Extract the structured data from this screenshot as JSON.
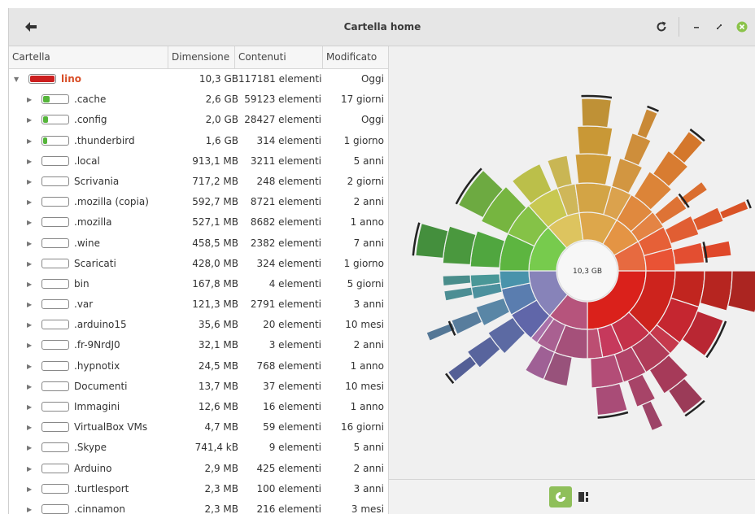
{
  "window": {
    "title": "Cartella home"
  },
  "columns": {
    "folder": "Cartella",
    "size": "Dimensione",
    "contents": "Contenuti",
    "modified": "Modificato"
  },
  "root": {
    "name": "lino",
    "size": "10,3 GB",
    "contents": "117181 elementi",
    "modified": "Oggi"
  },
  "rows": [
    {
      "name": ".cache",
      "size": "2,6 GB",
      "contents": "59123 elementi",
      "modified": "17 giorni",
      "fill": 0.25
    },
    {
      "name": ".config",
      "size": "2,0 GB",
      "contents": "28427 elementi",
      "modified": "Oggi",
      "fill": 0.19
    },
    {
      "name": ".thunderbird",
      "size": "1,6 GB",
      "contents": "314 elementi",
      "modified": "1 giorno",
      "fill": 0.15
    },
    {
      "name": ".local",
      "size": "913,1 MB",
      "contents": "3211 elementi",
      "modified": "5 anni",
      "fill": 0
    },
    {
      "name": "Scrivania",
      "size": "717,2 MB",
      "contents": "248 elementi",
      "modified": "2 giorni",
      "fill": 0
    },
    {
      "name": ".mozilla (copia)",
      "size": "592,7 MB",
      "contents": "8721 elementi",
      "modified": "2 anni",
      "fill": 0
    },
    {
      "name": ".mozilla",
      "size": "527,1 MB",
      "contents": "8682 elementi",
      "modified": "1 anno",
      "fill": 0
    },
    {
      "name": ".wine",
      "size": "458,5 MB",
      "contents": "2382 elementi",
      "modified": "7 anni",
      "fill": 0
    },
    {
      "name": "Scaricati",
      "size": "428,0 MB",
      "contents": "324 elementi",
      "modified": "1 giorno",
      "fill": 0
    },
    {
      "name": "bin",
      "size": "167,8 MB",
      "contents": "4 elementi",
      "modified": "5 giorni",
      "fill": 0
    },
    {
      "name": ".var",
      "size": "121,3 MB",
      "contents": "2791 elementi",
      "modified": "3 anni",
      "fill": 0
    },
    {
      "name": ".arduino15",
      "size": "35,6 MB",
      "contents": "20 elementi",
      "modified": "10 mesi",
      "fill": 0
    },
    {
      "name": ".fr-9NrdJ0",
      "size": "32,1 MB",
      "contents": "3 elementi",
      "modified": "2 anni",
      "fill": 0
    },
    {
      "name": ".hypnotix",
      "size": "24,5 MB",
      "contents": "768 elementi",
      "modified": "1 anno",
      "fill": 0
    },
    {
      "name": "Documenti",
      "size": "13,7 MB",
      "contents": "37 elementi",
      "modified": "10 mesi",
      "fill": 0
    },
    {
      "name": "Immagini",
      "size": "12,6 MB",
      "contents": "16 elementi",
      "modified": "1 anno",
      "fill": 0
    },
    {
      "name": "VirtualBox VMs",
      "size": "4,7 MB",
      "contents": "59 elementi",
      "modified": "16 giorni",
      "fill": 0
    },
    {
      "name": ".Skype",
      "size": "741,4 kB",
      "contents": "9 elementi",
      "modified": "5 anni",
      "fill": 0
    },
    {
      "name": "Arduino",
      "size": "2,9 MB",
      "contents": "425 elementi",
      "modified": "2 anni",
      "fill": 0
    },
    {
      "name": ".turtlesport",
      "size": "2,3 MB",
      "contents": "100 elementi",
      "modified": "3 anni",
      "fill": 0
    },
    {
      "name": ".cinnamon",
      "size": "2,3 MB",
      "contents": "216 elementi",
      "modified": "3 mesi",
      "fill": 0
    }
  ],
  "chart": {
    "center_label": "10,3 GB"
  },
  "colors": {
    "root_bar": "#cc1f1f",
    "usage_bar": "#55b53a",
    "accent": "#8fbf5a"
  },
  "icons": {
    "back": "arrow-left-icon",
    "reload": "reload-icon",
    "minimize": "minimize-icon",
    "maximize": "maximize-icon",
    "close": "close-icon",
    "ring_view": "ring-chart-icon",
    "treemap_view": "treemap-icon"
  }
}
